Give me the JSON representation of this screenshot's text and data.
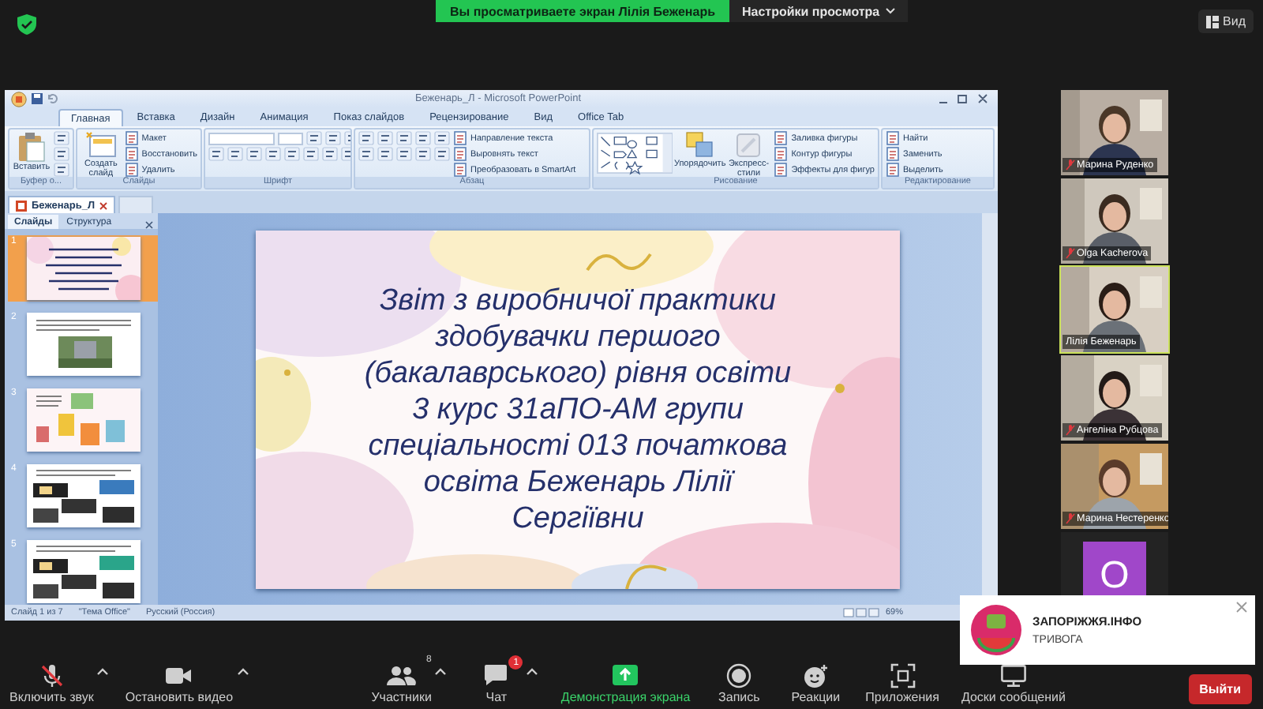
{
  "top_bar": {
    "sharing_banner": "Вы просматриваете экран Лілія Беженарь",
    "view_options": "Настройки просмотра",
    "view_button": "Вид"
  },
  "powerpoint": {
    "title": "Беженарь_Л - Microsoft PowerPoint",
    "tabs": [
      {
        "label": "Главная",
        "selected": true
      },
      {
        "label": "Вставка",
        "selected": false
      },
      {
        "label": "Дизайн",
        "selected": false
      },
      {
        "label": "Анимация",
        "selected": false
      },
      {
        "label": "Показ слайдов",
        "selected": false
      },
      {
        "label": "Рецензирование",
        "selected": false
      },
      {
        "label": "Вид",
        "selected": false
      },
      {
        "label": "Office Tab",
        "selected": false
      }
    ],
    "ribbon_groups": [
      {
        "kind": "clipboard",
        "name": "Буфер о...",
        "large": [
          "Вставить"
        ]
      },
      {
        "kind": "slides",
        "name": "Слайды",
        "large": [
          "Создать слайд"
        ],
        "small": [
          "Макет",
          "Восстановить",
          "Удалить"
        ]
      },
      {
        "kind": "font",
        "name": "Шрифт"
      },
      {
        "kind": "paragraph",
        "name": "Абзац",
        "small": [
          "Направление текста",
          "Выровнять текст",
          "Преобразовать в SmartArt"
        ]
      },
      {
        "kind": "drawing",
        "name": "Рисование",
        "large": [
          "Упорядочить",
          "Экспресс-стили"
        ],
        "small": [
          "Заливка фигуры",
          "Контур фигуры",
          "Эффекты для фигур"
        ]
      },
      {
        "kind": "editing",
        "name": "Редактирование",
        "small": [
          "Найти",
          "Заменить",
          "Выделить"
        ]
      }
    ],
    "document_tab": "Беженарь_Л",
    "panel_tabs": [
      {
        "label": "Слайды",
        "selected": true
      },
      {
        "label": "Структура",
        "selected": false
      }
    ],
    "thumbnails": [
      {
        "number": "1",
        "selected": true
      },
      {
        "number": "2",
        "selected": false
      },
      {
        "number": "3",
        "selected": false
      },
      {
        "number": "4",
        "selected": false
      },
      {
        "number": "5",
        "selected": false
      }
    ],
    "slide": {
      "lines": [
        "Звіт з виробничої практики",
        "здобувачки першого",
        "(бакалаврського) рівня освіти",
        "3 курс 31аПО-АМ групи",
        "спеціальності 013 початкова",
        "освіта Беженарь Лілії",
        "Сергіївни"
      ]
    },
    "status_bar": {
      "slide_count": "Слайд 1 из 7",
      "theme": "\"Тема Office\"",
      "language": "Русский (Россия)",
      "zoom": "69%"
    }
  },
  "participants": [
    {
      "kind": "video",
      "name": "Марина Руденко",
      "muted": true,
      "active": false
    },
    {
      "kind": "video",
      "name": "Olga Kacherova",
      "muted": true,
      "active": false
    },
    {
      "kind": "video",
      "name": "Лілія Беженарь",
      "muted": false,
      "active": true
    },
    {
      "kind": "video",
      "name": "Ангеліна Рубцова",
      "muted": true,
      "active": false
    },
    {
      "kind": "video",
      "name": "Марина Нестеренко",
      "muted": true,
      "active": false
    },
    {
      "kind": "avatar",
      "initial": "O",
      "active": false
    }
  ],
  "notification": {
    "title": "ЗАПОРІЖЖЯ.ІНФО",
    "body": "ТРИВОГА"
  },
  "toolbar": [
    {
      "kind": "mic",
      "label": "Включить звук",
      "muted": true,
      "caret": true
    },
    {
      "kind": "video",
      "label": "Остановить видео",
      "caret": true
    },
    {
      "kind": "participants",
      "label": "Участники",
      "count": "8",
      "caret": true
    },
    {
      "kind": "chat",
      "label": "Чат",
      "badge": "1",
      "caret": true
    },
    {
      "kind": "share",
      "label": "Демонстрация экрана",
      "active": true
    },
    {
      "kind": "record",
      "label": "Запись"
    },
    {
      "kind": "reactions",
      "label": "Реакции"
    },
    {
      "kind": "apps",
      "label": "Приложения"
    },
    {
      "kind": "whiteboards",
      "label": "Доски сообщений"
    }
  ],
  "leave_button": "Выйти"
}
